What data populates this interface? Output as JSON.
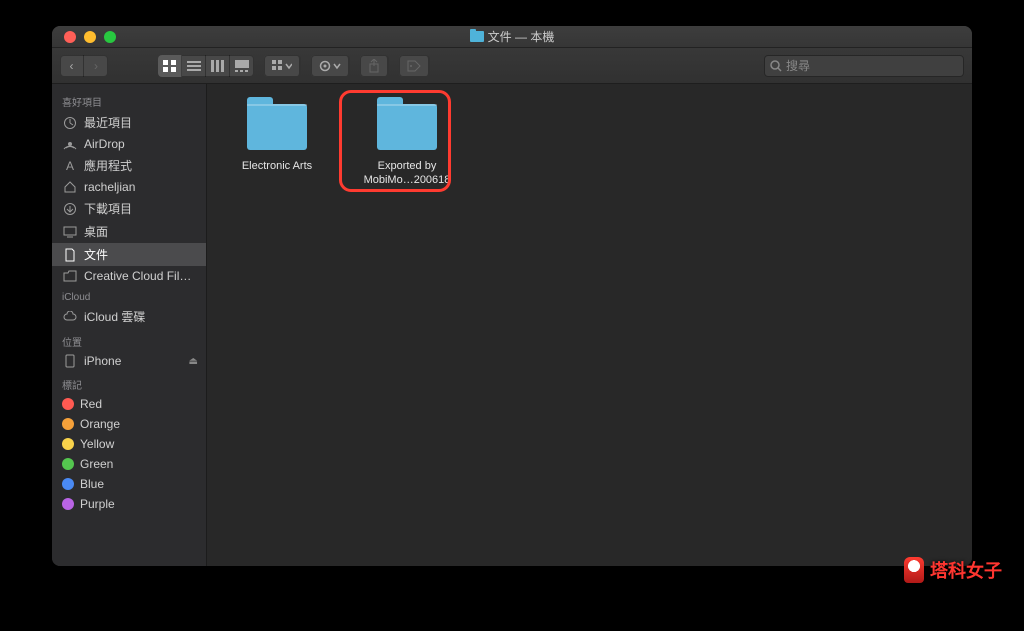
{
  "window": {
    "title": "文件 — 本機"
  },
  "search": {
    "placeholder": "搜尋"
  },
  "sidebar": {
    "favorites": {
      "label": "喜好項目",
      "items": [
        {
          "label": "最近項目",
          "icon": "recents-icon"
        },
        {
          "label": "AirDrop",
          "icon": "airdrop-icon"
        },
        {
          "label": "應用程式",
          "icon": "apps-icon"
        },
        {
          "label": "racheljian",
          "icon": "home-icon"
        },
        {
          "label": "下載項目",
          "icon": "downloads-icon"
        },
        {
          "label": "桌面",
          "icon": "desktop-icon"
        },
        {
          "label": "文件",
          "icon": "documents-icon",
          "active": true
        },
        {
          "label": "Creative Cloud Fil…",
          "icon": "folder-icon"
        }
      ]
    },
    "icloud": {
      "label": "iCloud",
      "items": [
        {
          "label": "iCloud 雲碟",
          "icon": "cloud-icon"
        }
      ]
    },
    "locations": {
      "label": "位置",
      "items": [
        {
          "label": "iPhone",
          "icon": "phone-icon",
          "ejectable": true
        }
      ]
    },
    "tags": {
      "label": "標記",
      "items": [
        {
          "label": "Red",
          "color": "tag-red"
        },
        {
          "label": "Orange",
          "color": "tag-orange"
        },
        {
          "label": "Yellow",
          "color": "tag-yellow"
        },
        {
          "label": "Green",
          "color": "tag-green"
        },
        {
          "label": "Blue",
          "color": "tag-blue"
        },
        {
          "label": "Purple",
          "color": "tag-purple"
        }
      ]
    }
  },
  "content": {
    "folders": [
      {
        "label": "Electronic Arts"
      },
      {
        "label": "Exported by\nMobiMo…200618",
        "highlighted": true
      }
    ]
  },
  "watermark": {
    "text": "塔科女子"
  }
}
